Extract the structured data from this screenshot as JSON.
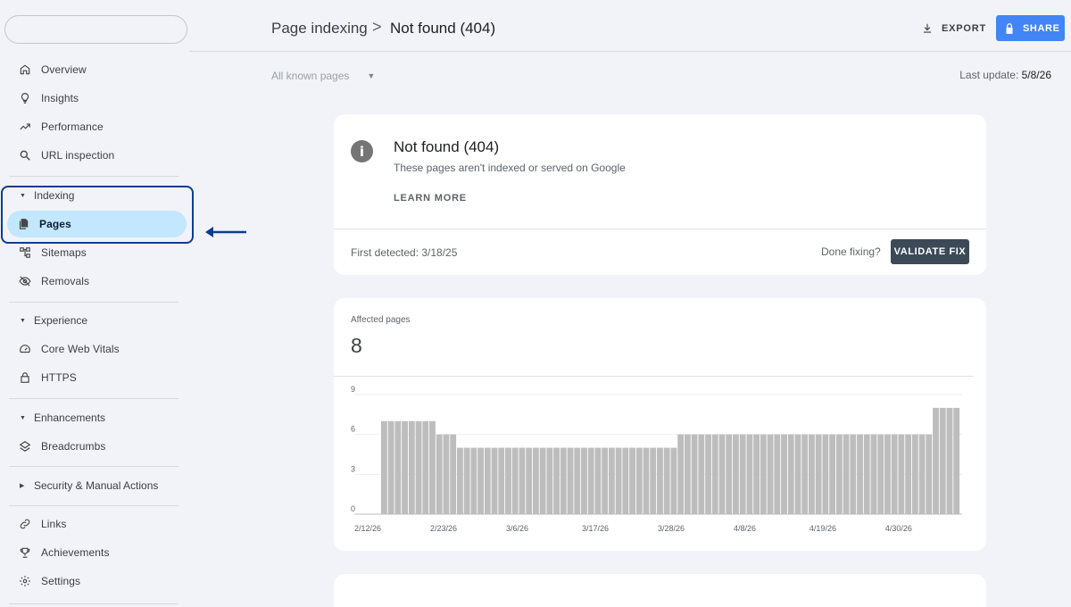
{
  "sidebar": {
    "search_placeholder": "",
    "top_items": [
      {
        "label": "Overview",
        "icon": "home-icon"
      },
      {
        "label": "Insights",
        "icon": "lightbulb-icon"
      },
      {
        "label": "Performance",
        "icon": "trending-up-icon"
      },
      {
        "label": "URL inspection",
        "icon": "search-icon"
      }
    ],
    "indexing": {
      "label": "Indexing",
      "items": [
        {
          "label": "Pages",
          "icon": "pages-icon",
          "selected": true
        },
        {
          "label": "Sitemaps",
          "icon": "sitemap-icon"
        },
        {
          "label": "Removals",
          "icon": "eye-off-icon"
        }
      ]
    },
    "experience": {
      "label": "Experience",
      "items": [
        {
          "label": "Core Web Vitals",
          "icon": "gauge-icon"
        },
        {
          "label": "HTTPS",
          "icon": "lock-icon"
        }
      ]
    },
    "enhancements": {
      "label": "Enhancements",
      "items": [
        {
          "label": "Breadcrumbs",
          "icon": "layers-icon"
        }
      ]
    },
    "security": {
      "label": "Security & Manual Actions"
    },
    "bottom_items": [
      {
        "label": "Links",
        "icon": "link-icon"
      },
      {
        "label": "Achievements",
        "icon": "trophy-icon"
      },
      {
        "label": "Settings",
        "icon": "gear-icon"
      }
    ]
  },
  "header": {
    "breadcrumb_parent": "Page indexing",
    "breadcrumb_separator": ">",
    "breadcrumb_current": "Not found (404)",
    "export_label": "EXPORT",
    "share_label": "SHARE",
    "accent_color": "#4285f4"
  },
  "filter": {
    "label": "All known pages"
  },
  "last_update": {
    "label": "Last update:",
    "value": "5/8/26"
  },
  "issue_card": {
    "title": "Not found (404)",
    "subtitle": "These pages aren't indexed or served on Google",
    "learn_more": "LEARN MORE",
    "first_detected": "First detected: 3/18/25",
    "done_fixing": "Done fixing?",
    "validate_label": "VALIDATE FIX"
  },
  "affected": {
    "label": "Affected pages",
    "value": "8"
  },
  "chart_data": {
    "type": "bar",
    "ylim": [
      0,
      9
    ],
    "yticks": [
      0,
      3,
      6,
      9
    ],
    "xtick_labels": [
      "2/12/26",
      "2/23/26",
      "3/6/26",
      "3/17/26",
      "3/28/26",
      "4/8/26",
      "4/19/26",
      "4/30/26"
    ],
    "xtick_indices": [
      0,
      11,
      22,
      33,
      44,
      55,
      66,
      77
    ],
    "values": [
      7,
      7,
      7,
      7,
      7,
      7,
      7,
      7,
      6,
      6,
      6,
      5,
      5,
      5,
      5,
      5,
      5,
      5,
      5,
      5,
      5,
      5,
      5,
      5,
      5,
      5,
      5,
      5,
      5,
      5,
      5,
      5,
      5,
      5,
      5,
      5,
      5,
      5,
      5,
      5,
      5,
      5,
      5,
      6,
      6,
      6,
      6,
      6,
      6,
      6,
      6,
      6,
      6,
      6,
      6,
      6,
      6,
      6,
      6,
      6,
      6,
      6,
      6,
      6,
      6,
      6,
      6,
      6,
      6,
      6,
      6,
      6,
      6,
      6,
      6,
      6,
      6,
      6,
      6,
      6,
      8,
      8,
      8,
      8
    ],
    "bar_color": "#bdbdbd",
    "grid": true
  }
}
